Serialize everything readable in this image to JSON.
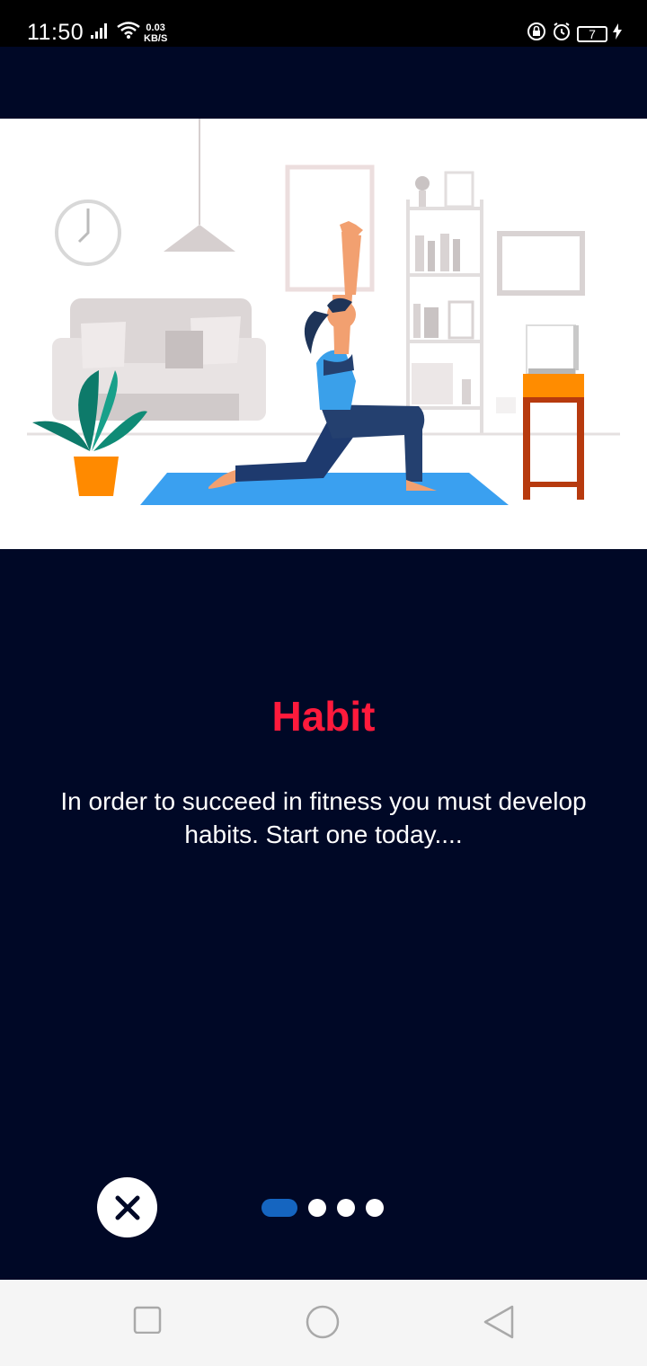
{
  "status_bar": {
    "time": "11:50",
    "net_speed_value": "0.03",
    "net_speed_unit": "KB/S",
    "battery_level": "7",
    "icons": [
      "signal-icon",
      "wifi-icon",
      "lock-icon",
      "alarm-icon",
      "battery-icon",
      "charging-icon"
    ]
  },
  "onboarding": {
    "title": "Habit",
    "description": "In order to succeed in fitness you must develop habits. Start one today....",
    "page_index": 0,
    "page_count": 4,
    "close_icon": "close-icon"
  },
  "nav_bar": {
    "items": [
      "recents-square-icon",
      "home-circle-icon",
      "back-triangle-icon"
    ]
  },
  "colors": {
    "background": "#000826",
    "title": "#ff1a3c",
    "active_dot": "#1565c0",
    "mat": "#3aa0f0"
  }
}
